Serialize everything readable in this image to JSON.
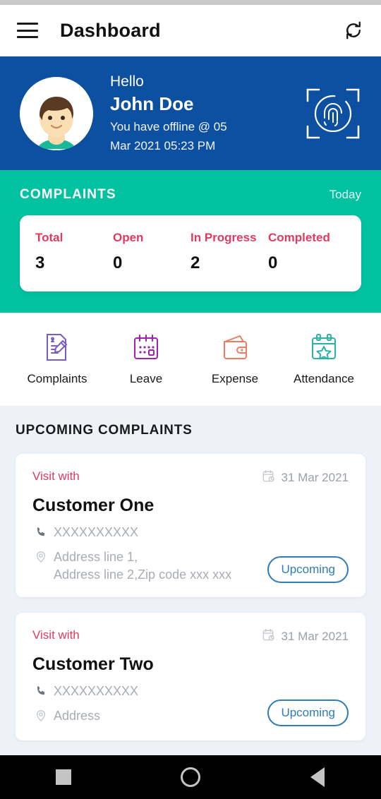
{
  "appbar": {
    "menu_icon": "hamburger-menu-icon",
    "title": "Dashboard",
    "refresh_icon": "refresh-icon"
  },
  "hero": {
    "avatar_icon": "user-avatar",
    "greeting": "Hello",
    "username": "John Doe",
    "status_line1": "You have offline @ 05",
    "status_line2": "Mar 2021 05:23 PM",
    "fingerprint_icon": "fingerprint-scan-icon",
    "bg_color": "#0d4fa1"
  },
  "complaints": {
    "title": "COMPLAINTS",
    "period": "Today",
    "bg_color": "#00c2a0",
    "label_color": "#e03a5f",
    "stats": [
      {
        "label": "Total",
        "value": "3"
      },
      {
        "label": "Open",
        "value": "0"
      },
      {
        "label": "In Progress",
        "value": "2"
      },
      {
        "label": "Completed",
        "value": "0"
      }
    ]
  },
  "quick_actions": [
    {
      "label": "Complaints",
      "icon": "document-pencil-icon",
      "color": "#7b5bc4"
    },
    {
      "label": "Leave",
      "icon": "calendar-dots-icon",
      "color": "#a020b0"
    },
    {
      "label": "Expense",
      "icon": "wallet-icon",
      "color": "#f07b63"
    },
    {
      "label": "Attendance",
      "icon": "calendar-star-icon",
      "color": "#2bb3a3"
    }
  ],
  "upcoming": {
    "title": "UPCOMING COMPLAINTS",
    "cards": [
      {
        "visit_label": "Visit with",
        "date": "31 Mar 2021",
        "date_icon": "calendar-clock-icon",
        "customer": "Customer One",
        "phone_icon": "phone-icon",
        "phone": "XXXXXXXXXX",
        "location_icon": "location-pin-icon",
        "address_line1": "Address line 1,",
        "address_line2": "Address line 2,Zip code xxx xxx",
        "badge": "Upcoming"
      },
      {
        "visit_label": "Visit with",
        "date": "31 Mar 2021",
        "date_icon": "calendar-clock-icon",
        "customer": "Customer Two",
        "phone_icon": "phone-icon",
        "phone": "XXXXXXXXXX",
        "location_icon": "location-pin-icon",
        "address_line1": "Address",
        "address_line2": "",
        "badge": "Upcoming"
      }
    ],
    "badge_color": "#2e7cb8"
  },
  "navbar": {
    "recents_icon": "square-recents-icon",
    "home_icon": "circle-home-icon",
    "back_icon": "triangle-back-icon"
  }
}
